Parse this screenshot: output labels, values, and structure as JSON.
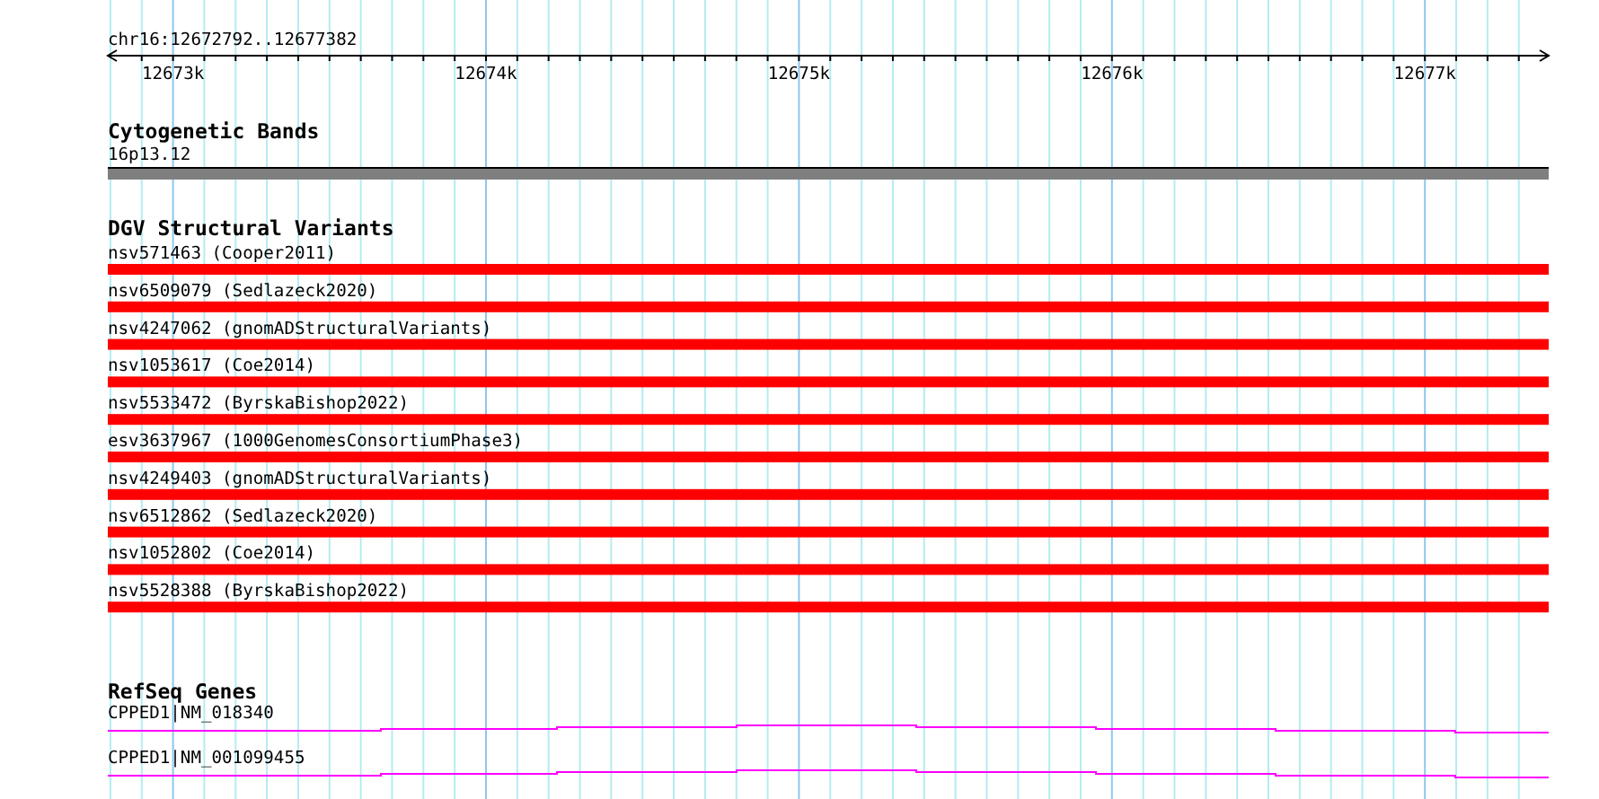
{
  "ruler": {
    "region": "chr16:12672792..12677382",
    "ticks": [
      "12673k",
      "12674k",
      "12675k",
      "12676k",
      "12677k"
    ]
  },
  "cytoband_track": {
    "title": "Cytogenetic Bands",
    "band": "16p13.12"
  },
  "variant_track": {
    "title": "DGV Structural Variants",
    "items": [
      {
        "label": "nsv571463 (Cooper2011)"
      },
      {
        "label": "nsv6509079 (Sedlazeck2020)"
      },
      {
        "label": "nsv4247062 (gnomADStructuralVariants)"
      },
      {
        "label": "nsv1053617 (Coe2014)"
      },
      {
        "label": "nsv5533472 (ByrskaBishop2022)"
      },
      {
        "label": "esv3637967 (1000GenomesConsortiumPhase3)"
      },
      {
        "label": "nsv4249403 (gnomADStructuralVariants)"
      },
      {
        "label": "nsv6512862 (Sedlazeck2020)"
      },
      {
        "label": "nsv1052802 (Coe2014)"
      },
      {
        "label": "nsv5528388 (ByrskaBishop2022)"
      }
    ]
  },
  "gene_track": {
    "title": "RefSeq Genes",
    "items": [
      {
        "label": "CPPED1|NM_018340"
      },
      {
        "label": "CPPED1|NM_001099455"
      }
    ]
  }
}
